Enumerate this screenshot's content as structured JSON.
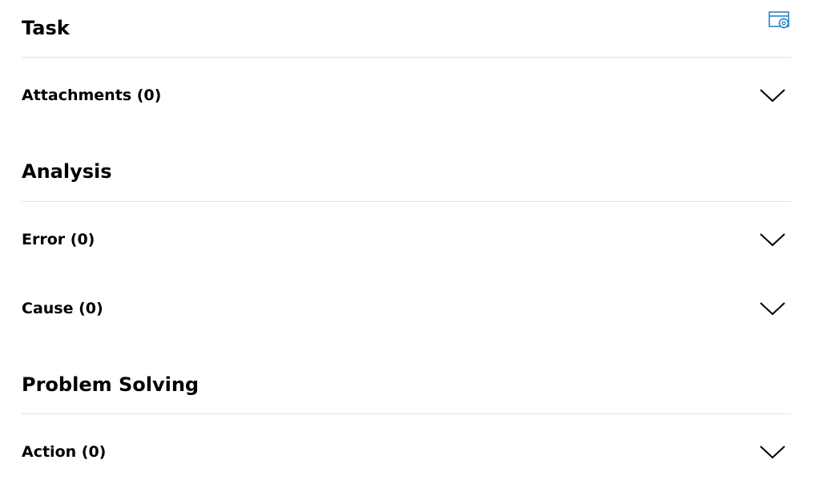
{
  "icons": {
    "settings": "window-settings-icon",
    "expand": "chevron-down-icon"
  },
  "colors": {
    "accent": "#1a7dbd",
    "divider": "#e0e2e5",
    "text": "#000000"
  },
  "sections": [
    {
      "title": "Task",
      "items": [
        {
          "label": "Attachments (0)"
        }
      ]
    },
    {
      "title": "Analysis",
      "items": [
        {
          "label": "Error (0)"
        },
        {
          "label": "Cause (0)"
        }
      ]
    },
    {
      "title": "Problem Solving",
      "items": [
        {
          "label": "Action (0)"
        }
      ]
    }
  ]
}
